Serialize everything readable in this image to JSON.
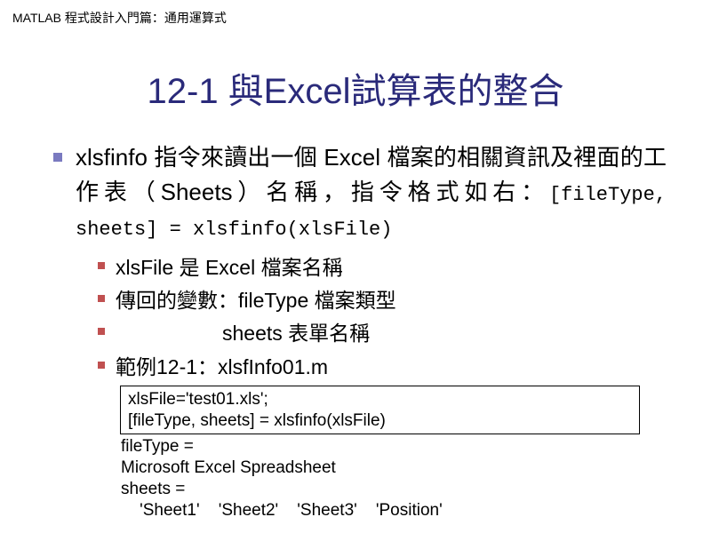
{
  "header": "MATLAB 程式設計入門篇：通用運算式",
  "title": "12-1 與Excel試算表的整合",
  "main_bullet": {
    "text_part1": "xlsfinfo 指令來讀出一個 Excel 檔案的相關資訊及裡面的工作表（Sheets）名稱，指令格式如右：",
    "code": "[fileType, sheets] = xlsfinfo(xlsFile)"
  },
  "sub_bullets": {
    "item1": "xlsFile 是 Excel 檔案名稱",
    "item2": "傳回的變數：fileType 檔案類型",
    "item3": "sheets 表單名稱",
    "item4_prefix": "範例12-1：",
    "item4_filename": "xlsfInfo01.m"
  },
  "code_box": {
    "line1": "xlsFile='test01.xls';",
    "line2": "[fileType, sheets] = xlsfinfo(xlsFile)"
  },
  "output": {
    "line1": "fileType =",
    "line2": "Microsoft Excel Spreadsheet",
    "line3": "sheets =",
    "line4": "    'Sheet1'    'Sheet2'    'Sheet3'    'Position'"
  }
}
